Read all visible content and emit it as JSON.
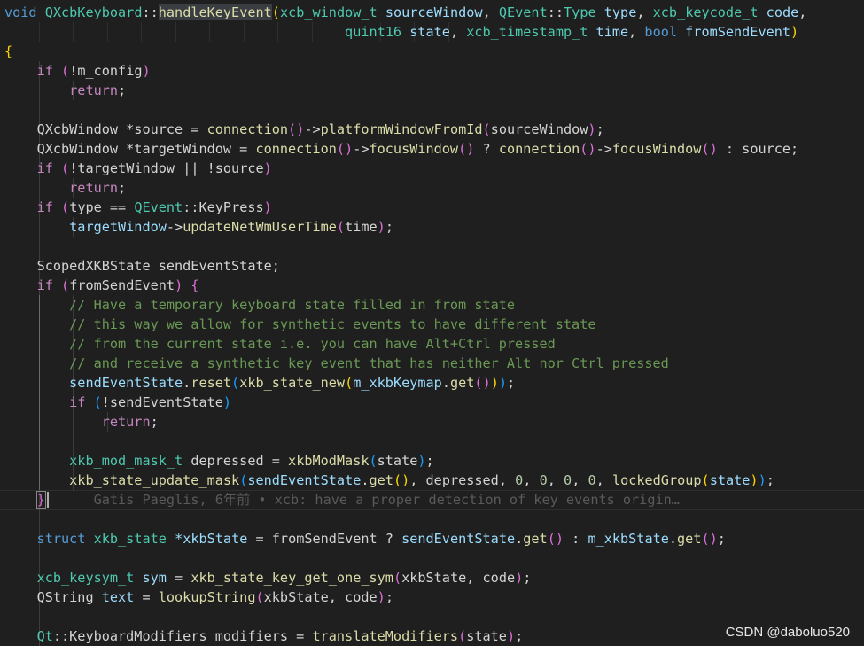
{
  "editor": {
    "lines": [
      [
        [
          "void",
          "kw"
        ],
        [
          " ",
          ""
        ],
        [
          "QXcbKeyboard",
          "type"
        ],
        [
          "::",
          "op"
        ],
        [
          "handleKeyEvent",
          "fn hl"
        ],
        [
          "(",
          "b1"
        ],
        [
          "xcb_window_t",
          "type"
        ],
        [
          " ",
          ""
        ],
        [
          "sourceWindow",
          "var"
        ],
        [
          ", ",
          ""
        ],
        [
          "QEvent",
          "type"
        ],
        [
          "::",
          "op"
        ],
        [
          "Type",
          "type"
        ],
        [
          " ",
          ""
        ],
        [
          "type",
          "var"
        ],
        [
          ", ",
          ""
        ],
        [
          "xcb_keycode_t",
          "type"
        ],
        [
          " ",
          ""
        ],
        [
          "code",
          "var"
        ],
        [
          ",",
          ""
        ]
      ],
      [
        [
          "                                          ",
          ""
        ],
        [
          "quint16",
          "type"
        ],
        [
          " ",
          ""
        ],
        [
          "state",
          "var"
        ],
        [
          ", ",
          ""
        ],
        [
          "xcb_timestamp_t",
          "type"
        ],
        [
          " ",
          ""
        ],
        [
          "time",
          "var"
        ],
        [
          ", ",
          ""
        ],
        [
          "bool",
          "kw"
        ],
        [
          " ",
          ""
        ],
        [
          "fromSendEvent",
          "var"
        ],
        [
          ")",
          "b1"
        ]
      ],
      [
        [
          "{",
          "b1"
        ]
      ],
      [
        [
          "    ",
          ""
        ],
        [
          "if",
          "ctrl"
        ],
        [
          " ",
          ""
        ],
        [
          "(",
          "b2"
        ],
        [
          "!m_config",
          ""
        ],
        [
          ")",
          "b2"
        ]
      ],
      [
        [
          "        ",
          ""
        ],
        [
          "return",
          "ctrl"
        ],
        [
          ";",
          ""
        ]
      ],
      [],
      [
        [
          "    ",
          ""
        ],
        [
          "QXcbWindow *source = ",
          ""
        ],
        [
          "connection",
          "fn"
        ],
        [
          "()",
          "b2"
        ],
        [
          "->",
          ""
        ],
        [
          "platformWindowFromId",
          "fn"
        ],
        [
          "(",
          "b2"
        ],
        [
          "sourceWindow",
          ""
        ],
        [
          ")",
          "b2"
        ],
        [
          ";",
          ""
        ]
      ],
      [
        [
          "    ",
          ""
        ],
        [
          "QXcbWindow *targetWindow = ",
          ""
        ],
        [
          "connection",
          "fn"
        ],
        [
          "()",
          "b2"
        ],
        [
          "->",
          ""
        ],
        [
          "focusWindow",
          "fn"
        ],
        [
          "()",
          "b2"
        ],
        [
          " ? ",
          ""
        ],
        [
          "connection",
          "fn"
        ],
        [
          "()",
          "b2"
        ],
        [
          "->",
          ""
        ],
        [
          "focusWindow",
          "fn"
        ],
        [
          "()",
          "b2"
        ],
        [
          " : source;",
          ""
        ]
      ],
      [
        [
          "    ",
          ""
        ],
        [
          "if",
          "ctrl"
        ],
        [
          " ",
          ""
        ],
        [
          "(",
          "b2"
        ],
        [
          "!targetWindow || !source",
          ""
        ],
        [
          ")",
          "b2"
        ]
      ],
      [
        [
          "        ",
          ""
        ],
        [
          "return",
          "ctrl"
        ],
        [
          ";",
          ""
        ]
      ],
      [
        [
          "    ",
          ""
        ],
        [
          "if",
          "ctrl"
        ],
        [
          " ",
          ""
        ],
        [
          "(",
          "b2"
        ],
        [
          "type == ",
          ""
        ],
        [
          "QEvent",
          "type"
        ],
        [
          "::KeyPress",
          ""
        ],
        [
          ")",
          "b2"
        ]
      ],
      [
        [
          "        ",
          ""
        ],
        [
          "targetWindow",
          "var"
        ],
        [
          "->",
          ""
        ],
        [
          "updateNetWmUserTime",
          "fn"
        ],
        [
          "(",
          "b2"
        ],
        [
          "time",
          ""
        ],
        [
          ")",
          "b2"
        ],
        [
          ";",
          ""
        ]
      ],
      [],
      [
        [
          "    ",
          ""
        ],
        [
          "ScopedXKBState sendEventState;",
          ""
        ]
      ],
      [
        [
          "    ",
          ""
        ],
        [
          "if",
          "ctrl"
        ],
        [
          " ",
          ""
        ],
        [
          "(",
          "b2"
        ],
        [
          "fromSendEvent",
          ""
        ],
        [
          ")",
          "b2"
        ],
        [
          " ",
          ""
        ],
        [
          "{",
          "b2"
        ]
      ],
      [
        [
          "        ",
          ""
        ],
        [
          "// Have a temporary keyboard state filled in from state",
          "cmt"
        ]
      ],
      [
        [
          "        ",
          ""
        ],
        [
          "// this way we allow for synthetic events to have different state",
          "cmt"
        ]
      ],
      [
        [
          "        ",
          ""
        ],
        [
          "// from the current state i.e. you can have Alt+Ctrl pressed",
          "cmt"
        ]
      ],
      [
        [
          "        ",
          ""
        ],
        [
          "// and receive a synthetic key event that has neither Alt nor Ctrl pressed",
          "cmt"
        ]
      ],
      [
        [
          "        ",
          ""
        ],
        [
          "sendEventState",
          "var"
        ],
        [
          ".",
          ""
        ],
        [
          "reset",
          "fn"
        ],
        [
          "(",
          "b3"
        ],
        [
          "xkb_state_new",
          "fn"
        ],
        [
          "(",
          "b1"
        ],
        [
          "m_xkbKeymap",
          "var"
        ],
        [
          ".",
          ""
        ],
        [
          "get",
          "fn"
        ],
        [
          "()",
          "b2"
        ],
        [
          ")",
          "b1"
        ],
        [
          ")",
          "b3"
        ],
        [
          ";",
          ""
        ]
      ],
      [
        [
          "        ",
          ""
        ],
        [
          "if",
          "ctrl"
        ],
        [
          " ",
          ""
        ],
        [
          "(",
          "b3"
        ],
        [
          "!sendEventState",
          ""
        ],
        [
          ")",
          "b3"
        ]
      ],
      [
        [
          "            ",
          ""
        ],
        [
          "return",
          "ctrl"
        ],
        [
          ";",
          ""
        ]
      ],
      [],
      [
        [
          "        ",
          ""
        ],
        [
          "xkb_mod_mask_t",
          "type"
        ],
        [
          " depressed = ",
          ""
        ],
        [
          "xkbModMask",
          "fn"
        ],
        [
          "(",
          "b3"
        ],
        [
          "state",
          ""
        ],
        [
          ")",
          "b3"
        ],
        [
          ";",
          ""
        ]
      ],
      [
        [
          "        ",
          ""
        ],
        [
          "xkb_state_update_mask",
          "fn"
        ],
        [
          "(",
          "b3"
        ],
        [
          "sendEventState",
          "var"
        ],
        [
          ".",
          ""
        ],
        [
          "get",
          "fn"
        ],
        [
          "()",
          "b1"
        ],
        [
          ", depressed, ",
          ""
        ],
        [
          "0",
          "num"
        ],
        [
          ", ",
          ""
        ],
        [
          "0",
          "num"
        ],
        [
          ", ",
          ""
        ],
        [
          "0",
          "num"
        ],
        [
          ", ",
          ""
        ],
        [
          "0",
          "num"
        ],
        [
          ", ",
          ""
        ],
        [
          "lockedGroup",
          "fn"
        ],
        [
          "(",
          "b1"
        ],
        [
          "state",
          "var"
        ],
        [
          ")",
          "b1"
        ],
        [
          ")",
          "b3"
        ],
        [
          ";",
          ""
        ]
      ],
      [
        [
          "    ",
          ""
        ],
        [
          "}",
          "b2 bracket-box"
        ],
        [
          "      ",
          ""
        ],
        [
          "Gatis Paeglis, 6年前 • xcb: have a proper detection of key events origin…",
          "blame"
        ]
      ],
      [],
      [
        [
          "    ",
          ""
        ],
        [
          "struct",
          "kw"
        ],
        [
          " ",
          ""
        ],
        [
          "xkb_state",
          "type"
        ],
        [
          " ",
          ""
        ],
        [
          "*xkbState",
          "var"
        ],
        [
          " = fromSendEvent ? ",
          ""
        ],
        [
          "sendEventState",
          "var"
        ],
        [
          ".",
          ""
        ],
        [
          "get",
          "fn"
        ],
        [
          "()",
          "b2"
        ],
        [
          " : ",
          ""
        ],
        [
          "m_xkbState",
          "var"
        ],
        [
          ".",
          ""
        ],
        [
          "get",
          "fn"
        ],
        [
          "()",
          "b2"
        ],
        [
          ";",
          ""
        ]
      ],
      [],
      [
        [
          "    ",
          ""
        ],
        [
          "xcb_keysym_t",
          "type"
        ],
        [
          " ",
          ""
        ],
        [
          "sym",
          "var"
        ],
        [
          " = ",
          ""
        ],
        [
          "xkb_state_key_get_one_sym",
          "fn"
        ],
        [
          "(",
          "b2"
        ],
        [
          "xkbState, code",
          ""
        ],
        [
          ")",
          "b2"
        ],
        [
          ";",
          ""
        ]
      ],
      [
        [
          "    ",
          ""
        ],
        [
          "QString ",
          ""
        ],
        [
          "text",
          "var"
        ],
        [
          " = ",
          ""
        ],
        [
          "lookupString",
          "fn"
        ],
        [
          "(",
          "b2"
        ],
        [
          "xkbState, code",
          ""
        ],
        [
          ")",
          "b2"
        ],
        [
          ";",
          ""
        ]
      ],
      [],
      [
        [
          "    ",
          ""
        ],
        [
          "Qt",
          "type"
        ],
        [
          "::KeyboardModifiers modifiers = ",
          ""
        ],
        [
          "translateModifiers",
          "fn"
        ],
        [
          "(",
          "b2"
        ],
        [
          "state",
          ""
        ],
        [
          ")",
          "b2"
        ],
        [
          ";",
          ""
        ]
      ]
    ],
    "guides": [
      [
        1,
        [
          1,
          2,
          3,
          4,
          5,
          6,
          7,
          8,
          9,
          10,
          11,
          12,
          13
        ]
      ],
      [
        3,
        [
          1
        ]
      ],
      [
        4,
        [
          1,
          2
        ]
      ],
      [
        5,
        [
          1
        ]
      ],
      [
        6,
        [
          1
        ]
      ],
      [
        7,
        [
          1
        ]
      ],
      [
        8,
        [
          1
        ]
      ],
      [
        9,
        [
          1,
          2
        ]
      ],
      [
        10,
        [
          1
        ]
      ],
      [
        11,
        [
          1,
          2
        ]
      ],
      [
        12,
        [
          1
        ]
      ],
      [
        13,
        [
          1
        ]
      ],
      [
        14,
        [
          1
        ]
      ],
      [
        15,
        [
          1,
          2
        ]
      ],
      [
        16,
        [
          1,
          2
        ]
      ],
      [
        17,
        [
          1,
          2
        ]
      ],
      [
        18,
        [
          1,
          2
        ]
      ],
      [
        19,
        [
          1,
          2
        ]
      ],
      [
        20,
        [
          1,
          2
        ]
      ],
      [
        21,
        [
          1,
          2,
          3
        ]
      ],
      [
        22,
        [
          1,
          2
        ]
      ],
      [
        23,
        [
          1,
          2
        ]
      ],
      [
        24,
        [
          1,
          2
        ]
      ],
      [
        25,
        [
          1
        ]
      ],
      [
        26,
        [
          1
        ]
      ],
      [
        27,
        [
          1
        ]
      ],
      [
        28,
        [
          1
        ]
      ],
      [
        29,
        [
          1
        ]
      ],
      [
        30,
        [
          1
        ]
      ],
      [
        31,
        [
          1
        ]
      ],
      [
        32,
        [
          1
        ]
      ]
    ],
    "current_line": 25
  },
  "watermark": {
    "text": "CSDN @daboluo520"
  }
}
